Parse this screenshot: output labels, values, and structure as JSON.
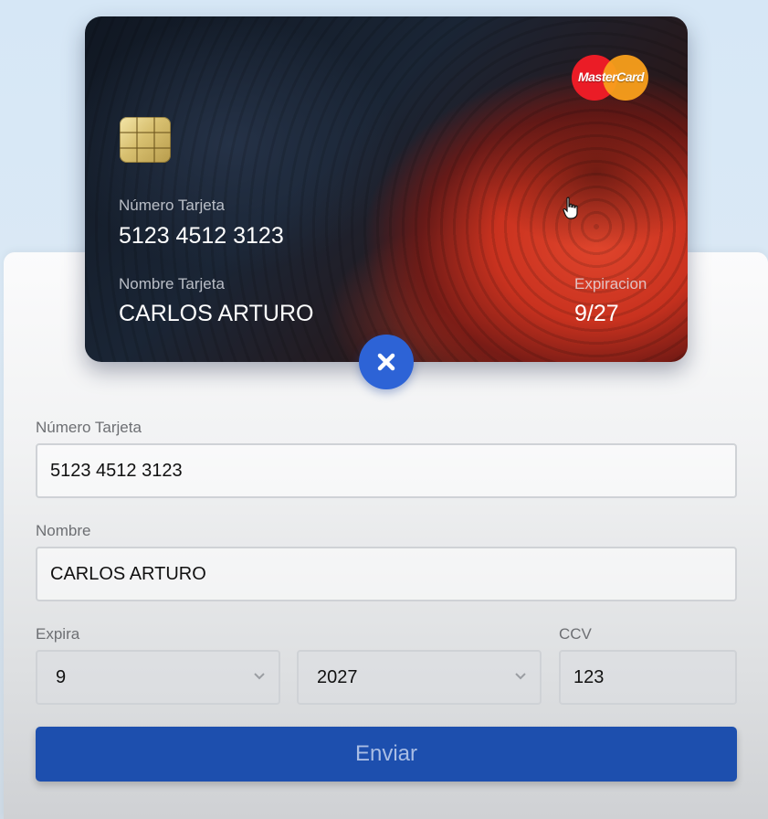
{
  "card": {
    "brand": "MasterCard",
    "number_label": "Número Tarjeta",
    "number_value": "5123 4512 3123",
    "name_label": "Nombre Tarjeta",
    "name_value": "CARLOS ARTURO",
    "expiry_label": "Expiracion",
    "expiry_value": "9/27"
  },
  "close_icon": "close-icon",
  "form": {
    "number_label": "Número Tarjeta",
    "number_value": "5123 4512 3123",
    "name_label": "Nombre",
    "name_value": "CARLOS ARTURO",
    "expiry_label": "Expira",
    "month_value": "9",
    "year_value": "2027",
    "ccv_label": "CCV",
    "ccv_value": "123",
    "submit_label": "Enviar"
  },
  "colors": {
    "accent": "#2d63d6",
    "submit": "#1d4fae"
  }
}
